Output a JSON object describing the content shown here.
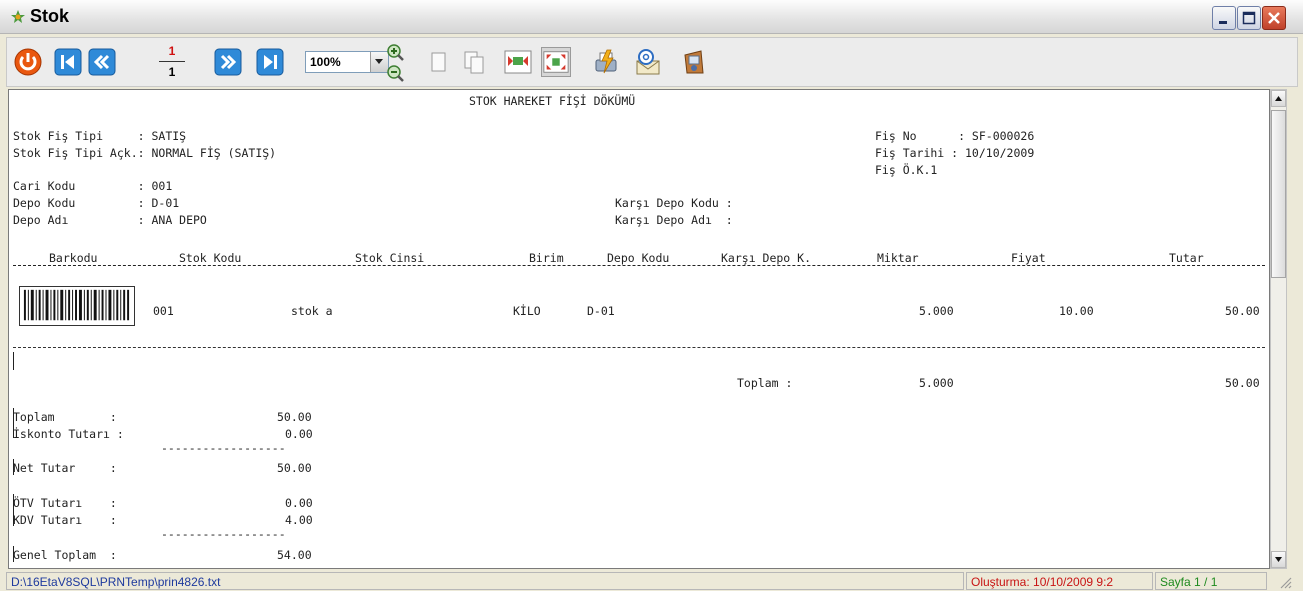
{
  "window": {
    "title": "Stok"
  },
  "toolbar": {
    "page_current": "1",
    "page_total": "1",
    "zoom": "100%",
    "buttons": [
      {
        "name": "close-report-icon",
        "color": "#e85c0c"
      },
      {
        "name": "first-page-icon",
        "color": "#1f7fd0"
      },
      {
        "name": "prev-page-icon",
        "color": "#1f7fd0"
      },
      {
        "name": "next-page-icon",
        "color": "#1f7fd0"
      },
      {
        "name": "last-page-icon",
        "color": "#1f7fd0"
      }
    ]
  },
  "report": {
    "title": "STOK HAREKET FİŞİ DÖKÜMÜ",
    "header_left": [
      "Stok Fiş Tipi     : SATIŞ",
      "Stok Fiş Tipi Açk.: NORMAL FİŞ (SATIŞ)",
      "",
      "Cari Kodu         : 001",
      "Depo Kodu         : D-01",
      "Depo Adı          : ANA DEPO"
    ],
    "header_right": [
      "Fiş No      : SF-000026",
      "Fiş Tarihi : 10/10/2009",
      "Fiş Ö.K.1"
    ],
    "karsi_depo_kodu": "Karşı Depo Kodu :",
    "karsi_depo_adi": "Karşı Depo Adı  :",
    "columns": {
      "barkodu": "Barkodu",
      "stok_kodu": "Stok Kodu",
      "stok_cinsi": "Stok Cinsi",
      "birim": "Birim",
      "depo_kodu": "Depo Kodu",
      "karsi_depo": "Karşı Depo K.",
      "miktar": "Miktar",
      "fiyat": "Fiyat",
      "tutar": "Tutar"
    },
    "row": {
      "stok_kodu": "001",
      "stok_cinsi": "stok a",
      "birim": "KİLO",
      "depo_kodu": "D-01",
      "miktar": "5.000",
      "fiyat": "10.00",
      "tutar": "50.00"
    },
    "toplam_label": "Toplam :",
    "toplam_miktar": "5.000",
    "toplam_tutar": "50.00",
    "summary": [
      {
        "label": "Toplam        :",
        "value": "50.00"
      },
      {
        "label": "İskonto Tutarı :",
        "value": "0.00"
      },
      {
        "label": "Net Tutar     :",
        "value": "50.00"
      },
      {
        "label": "ÖTV Tutarı    :",
        "value": "0.00"
      },
      {
        "label": "KDV Tutarı    :",
        "value": "4.00"
      },
      {
        "label": "Genel Toplam  :",
        "value": "54.00"
      }
    ],
    "summary_separator": "------------------"
  },
  "status": {
    "path": "D:\\16EtaV8SQL\\PRNTemp\\prin4826.txt",
    "created": "Oluşturma: 10/10/2009 9:2",
    "page": "Sayfa  1 / 1"
  }
}
